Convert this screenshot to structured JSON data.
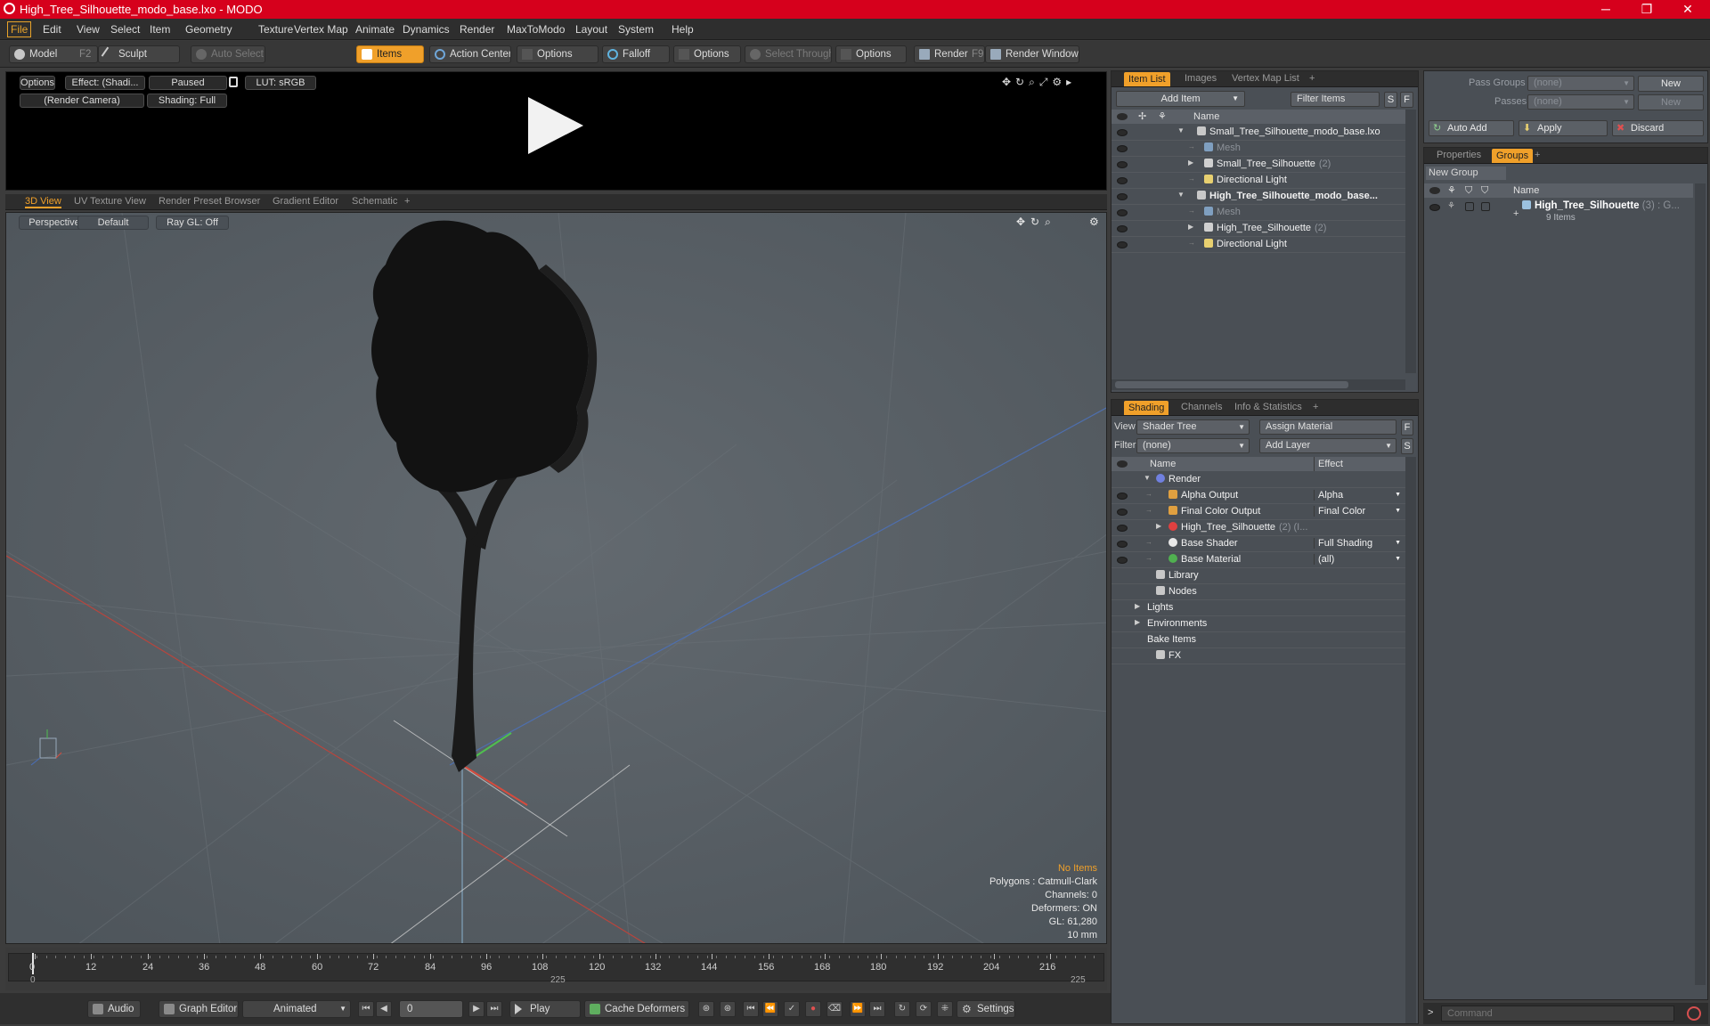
{
  "window": {
    "title": "High_Tree_Silhouette_modo_base.lxo - MODO",
    "minimize": "─",
    "maximize": "❐",
    "close": "✕"
  },
  "menu": [
    "File",
    "Edit",
    "View",
    "Select",
    "Item",
    "Geometry",
    "Texture",
    "Vertex Map",
    "Animate",
    "Dynamics",
    "Render",
    "MaxToModo",
    "Layout",
    "System",
    "Help"
  ],
  "toolbar": {
    "model": "Model",
    "model_key": "F2",
    "sculpt": "Sculpt",
    "auto_select": "Auto Select",
    "items": "Items",
    "action_center": "Action Center",
    "options1": "Options",
    "falloff": "Falloff",
    "options2": "Options",
    "select_through": "Select Through",
    "options3": "Options",
    "render": "Render",
    "render_key": "F9",
    "render_window": "Render Window"
  },
  "preview": {
    "options": "Options",
    "effect": "Effect: (Shadi...",
    "paused": "Paused",
    "lut": "LUT: sRGB",
    "camera": "(Render Camera)",
    "shading": "Shading: Full"
  },
  "view_tabs": [
    "3D View",
    "UV Texture View",
    "Render Preset Browser",
    "Gradient Editor",
    "Schematic",
    "+"
  ],
  "viewport": {
    "perspective": "Perspective",
    "default": "Default",
    "raygl": "Ray GL: Off",
    "info": [
      "No Items",
      "Polygons : Catmull-Clark",
      "Channels: 0",
      "Deformers: ON",
      "GL: 61,280",
      "10 mm"
    ]
  },
  "timeline": {
    "labels": [
      "0",
      "12",
      "24",
      "36",
      "48",
      "60",
      "72",
      "84",
      "96",
      "108",
      "120",
      "132",
      "144",
      "156",
      "168",
      "180",
      "192",
      "204",
      "216"
    ],
    "start": "0",
    "mid": "225",
    "end": "225"
  },
  "bottom": {
    "audio": "Audio",
    "graph_editor": "Graph Editor",
    "animated": "Animated",
    "frame": "0",
    "play": "Play",
    "cache_deformers": "Cache Deformers",
    "settings": "Settings"
  },
  "item_panel": {
    "tabs": [
      "Item List",
      "Images",
      "Vertex Map List",
      "+"
    ],
    "add_item": "Add Item",
    "filter_items": "Filter Items",
    "s": "S",
    "f": "F",
    "col_name": "Name",
    "rows": [
      {
        "label": "Small_Tree_Silhouette_modo_base.lxo",
        "indent": 0,
        "arrow": "▼",
        "icon": "scene",
        "bold": false,
        "dim": false
      },
      {
        "label": "Mesh",
        "indent": 1,
        "arrow": "",
        "icon": "mesh",
        "bold": false,
        "dim": true
      },
      {
        "label": "Small_Tree_Silhouette",
        "count": "(2)",
        "indent": 1,
        "arrow": "▶",
        "icon": "group",
        "bold": false,
        "dim": false
      },
      {
        "label": "Directional Light",
        "indent": 1,
        "arrow": "",
        "icon": "light",
        "bold": false,
        "dim": false
      },
      {
        "label": "High_Tree_Silhouette_modo_base...",
        "indent": 0,
        "arrow": "▼",
        "icon": "scene",
        "bold": true,
        "dim": false
      },
      {
        "label": "Mesh",
        "indent": 1,
        "arrow": "",
        "icon": "mesh",
        "bold": false,
        "dim": true
      },
      {
        "label": "High_Tree_Silhouette",
        "count": "(2)",
        "indent": 1,
        "arrow": "▶",
        "icon": "group",
        "bold": false,
        "dim": false
      },
      {
        "label": "Directional Light",
        "indent": 1,
        "arrow": "",
        "icon": "light",
        "bold": false,
        "dim": false
      }
    ]
  },
  "shading_panel": {
    "tabs": [
      "Shading",
      "Channels",
      "Info & Statistics",
      "+"
    ],
    "view_label": "View",
    "view_value": "Shader Tree",
    "assign_material": "Assign Material",
    "filter_label": "Filter",
    "filter_value": "(none)",
    "add_layer": "Add Layer",
    "f": "F",
    "s": "S",
    "col_name": "Name",
    "col_effect": "Effect",
    "rows": [
      {
        "label": "Render",
        "effect": "",
        "indent": 0,
        "arrow": "▼",
        "icon": "render",
        "eye": false
      },
      {
        "label": "Alpha Output",
        "effect": "Alpha",
        "indent": 1,
        "arrow": "",
        "icon": "output",
        "eye": true
      },
      {
        "label": "Final Color Output",
        "effect": "Final Color",
        "indent": 1,
        "arrow": "",
        "icon": "output",
        "eye": true
      },
      {
        "label": "High_Tree_Silhouette",
        "count": "(2) (I...",
        "effect": "",
        "indent": 1,
        "arrow": "▶",
        "icon": "mat",
        "eye": true
      },
      {
        "label": "Base Shader",
        "effect": "Full Shading",
        "indent": 1,
        "arrow": "",
        "icon": "shader",
        "eye": true
      },
      {
        "label": "Base Material",
        "effect": "(all)",
        "indent": 1,
        "arrow": "",
        "icon": "basemat",
        "eye": true
      },
      {
        "label": "Library",
        "effect": "",
        "indent": 0,
        "arrow": "",
        "icon": "folder",
        "eye": false
      },
      {
        "label": "Nodes",
        "effect": "",
        "indent": 0,
        "arrow": "",
        "icon": "folder",
        "eye": false
      },
      {
        "label": "Lights",
        "effect": "",
        "indent": -1,
        "arrow": "▶",
        "icon": "",
        "eye": false
      },
      {
        "label": "Environments",
        "effect": "",
        "indent": -1,
        "arrow": "▶",
        "icon": "",
        "eye": false
      },
      {
        "label": "Bake Items",
        "effect": "",
        "indent": -1,
        "arrow": "",
        "icon": "",
        "eye": false
      },
      {
        "label": "FX",
        "effect": "",
        "indent": 0,
        "arrow": "",
        "icon": "fx",
        "eye": false
      }
    ]
  },
  "pass_panel": {
    "pass_groups": "Pass Groups",
    "passes": "Passes",
    "none1": "(none)",
    "none2": "(none)",
    "new1": "New",
    "new2": "New",
    "auto_add": "Auto Add",
    "apply": "Apply",
    "discard": "Discard"
  },
  "groups_panel": {
    "tabs": [
      "Properties",
      "Groups",
      "+"
    ],
    "new_group": "New Group",
    "col_name": "Name",
    "group_name": "High_Tree_Silhouette",
    "group_count": "(3) : G...",
    "group_items": "9 Items"
  },
  "command": {
    "placeholder": "Command",
    "prompt": ">"
  }
}
